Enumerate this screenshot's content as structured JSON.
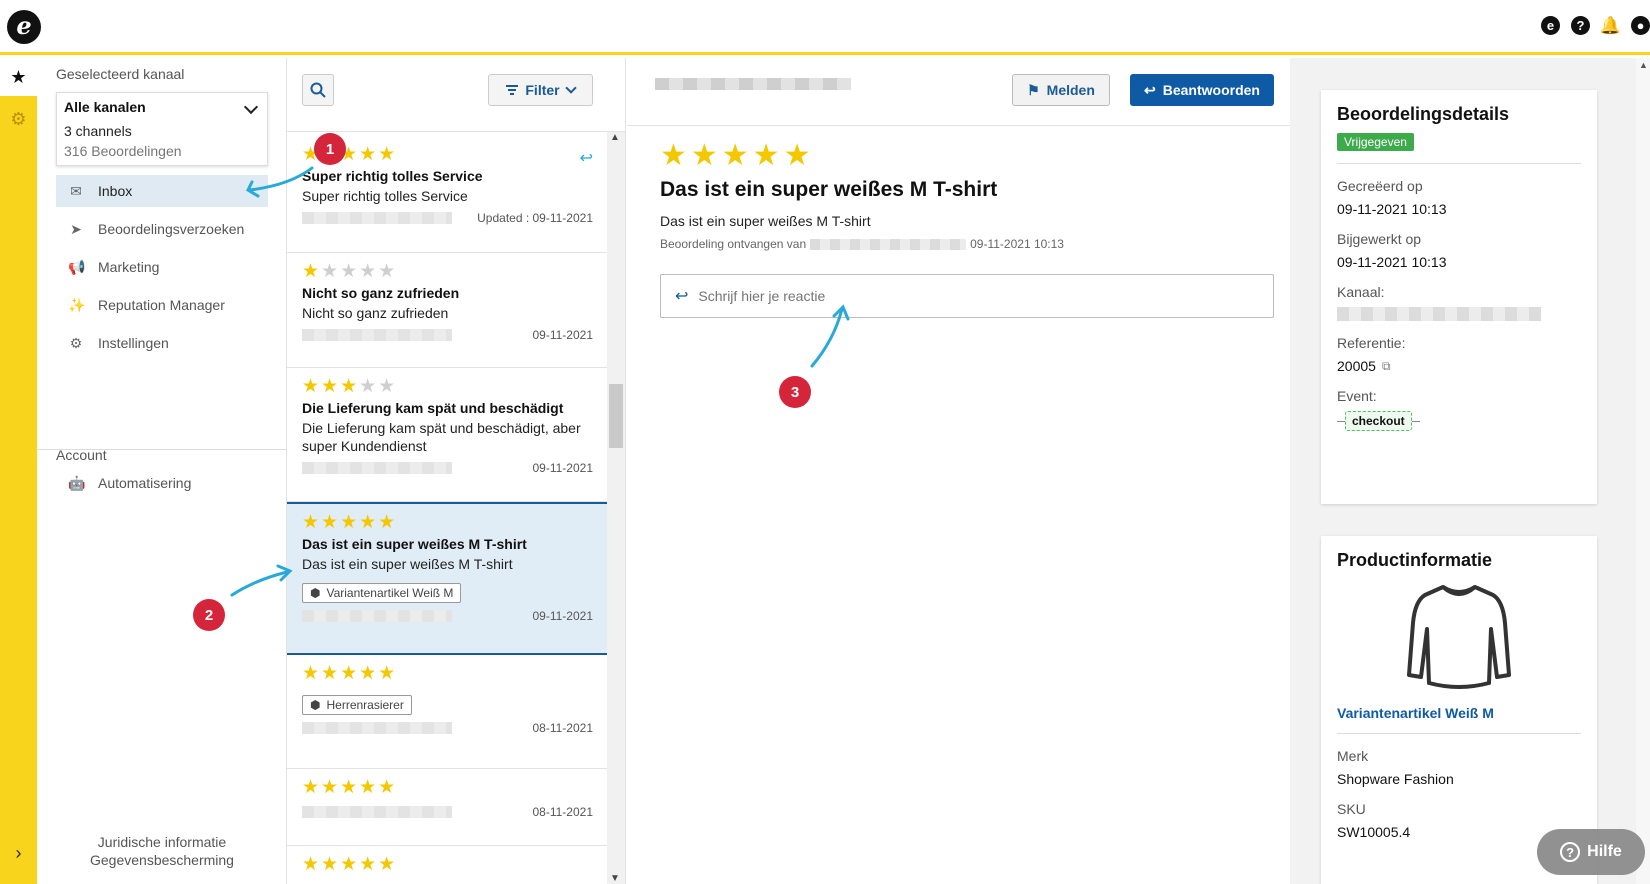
{
  "topbar": {
    "logo_glyph": "e",
    "icons": [
      "etrusted-icon",
      "help-icon",
      "bell-icon",
      "user-icon"
    ]
  },
  "rail": {
    "star_icon": "★",
    "gear_icon": "⚙",
    "expand_icon": "›"
  },
  "sidebar": {
    "channel_label": "Geselecteerd kanaal",
    "channel_title": "Alle kanalen",
    "channel_sub": "3 channels",
    "channel_count": "316 Beoordelingen",
    "items": [
      {
        "label": "Inbox",
        "icon": "inbox-icon",
        "active": true
      },
      {
        "label": "Beoordelingsverzoeken",
        "icon": "send-icon"
      },
      {
        "label": "Marketing",
        "icon": "megaphone-icon"
      },
      {
        "label": "Reputation Manager",
        "icon": "sparkle-icon"
      },
      {
        "label": "Instellingen",
        "icon": "gear-icon"
      }
    ],
    "account_label": "Account",
    "account_items": [
      {
        "label": "Automatisering",
        "icon": "robot-icon"
      }
    ],
    "footer": [
      "Juridische informatie",
      "Gegevensbescherming"
    ]
  },
  "list": {
    "filter_label": "Filter",
    "reviews": [
      {
        "stars": 5,
        "title": "Super richtig tolles Service",
        "text": "Super richtig tolles Service",
        "date": "Updated : 09-11-2021",
        "replied": true
      },
      {
        "stars": 1,
        "title": "Nicht so ganz zufrieden",
        "text": "Nicht so ganz zufrieden",
        "date": "09-11-2021"
      },
      {
        "stars": 3,
        "title": "Die Lieferung kam spät und beschädigt",
        "text": "Die Lieferung kam spät und beschädigt, aber super Kundendienst",
        "date": "09-11-2021"
      },
      {
        "stars": 5,
        "title": "Das ist ein super weißes M T-shirt",
        "text": "Das ist ein super weißes M T-shirt",
        "tag": "Variantenartikel Weiß M",
        "date": "09-11-2021",
        "selected": true
      },
      {
        "stars": 5,
        "tag": "Herrenrasierer",
        "date": "08-11-2021"
      },
      {
        "stars": 5,
        "date": "08-11-2021"
      },
      {
        "stars": 5
      }
    ]
  },
  "detail": {
    "report_label": "Melden",
    "reply_label": "Beantwoorden",
    "stars": 5,
    "title": "Das ist ein super weißes M T-shirt",
    "text": "Das ist ein super weißes M T-shirt",
    "received_label": "Beoordeling ontvangen van",
    "received_date": "09-11-2021 10:13",
    "reply_placeholder": "Schrijf hier je reactie"
  },
  "review_details": {
    "title": "Beoordelingsdetails",
    "status": "Vrijgegeven",
    "created_label": "Gecreëerd op",
    "created_value": "09-11-2021 10:13",
    "updated_label": "Bijgewerkt op",
    "updated_value": "09-11-2021 10:13",
    "channel_label": "Kanaal:",
    "reference_label": "Referentie:",
    "reference_value": "20005",
    "event_label": "Event:",
    "event_value": "checkout"
  },
  "product": {
    "title": "Productinformatie",
    "name": "Variantenartikel Weiß M",
    "brand_label": "Merk",
    "brand_value": "Shopware Fashion",
    "sku_label": "SKU",
    "sku_value": "SW10005.4"
  },
  "help": {
    "label": "Hilfe"
  },
  "annotations": [
    "1",
    "2",
    "3"
  ],
  "colors": {
    "accent_yellow": "#f8d51c",
    "primary_blue": "#0f5aa5",
    "star": "#f4c800",
    "annotation_red": "#d5253a",
    "arrow_cyan": "#29a9d8",
    "status_green": "#3dab4c"
  }
}
